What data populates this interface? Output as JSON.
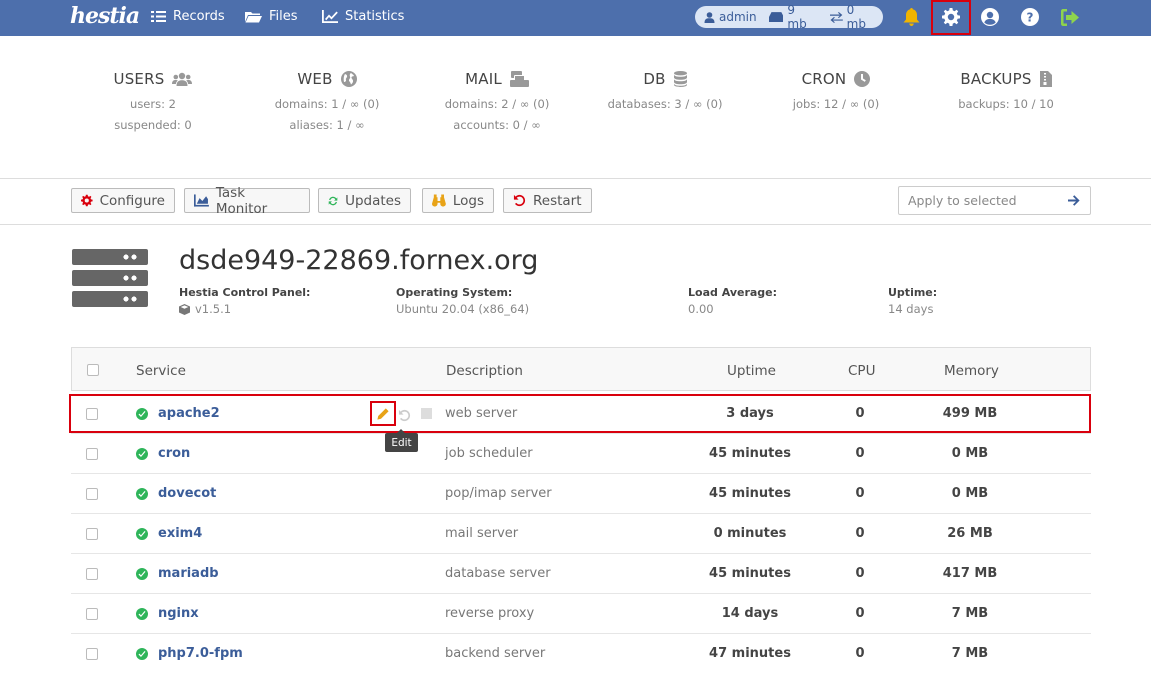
{
  "nav": {
    "logo": "hestia",
    "records": "Records",
    "files": "Files",
    "statistics": "Statistics",
    "user": "admin",
    "disk": "9 mb",
    "bandwidth": "0 mb"
  },
  "stats": [
    {
      "title": "USERS",
      "line1": "users: 2",
      "line2": "suspended: 0",
      "icon": "users-icon"
    },
    {
      "title": "WEB",
      "line1": "domains: 1 / ∞ (0)",
      "line2": "aliases: 1 / ∞",
      "icon": "globe-icon"
    },
    {
      "title": "MAIL",
      "line1": "domains: 2 / ∞ (0)",
      "line2": "accounts: 0 / ∞",
      "icon": "mail-icon"
    },
    {
      "title": "DB",
      "line1": "databases: 3 / ∞ (0)",
      "line2": "",
      "icon": "database-icon"
    },
    {
      "title": "CRON",
      "line1": "jobs: 12 / ∞ (0)",
      "line2": "",
      "icon": "clock-icon"
    },
    {
      "title": "BACKUPS",
      "line1": "backups: 10 / 10",
      "line2": "",
      "icon": "file-icon"
    }
  ],
  "toolbar": {
    "configure": "Configure",
    "task_monitor": "Task Monitor",
    "updates": "Updates",
    "logs": "Logs",
    "restart": "Restart",
    "apply_placeholder": "Apply to selected"
  },
  "server": {
    "hostname": "dsde949-22869.fornex.org",
    "panel_label": "Hestia Control Panel:",
    "panel_value": "v1.5.1",
    "os_label": "Operating System:",
    "os_value": "Ubuntu 20.04 (x86_64)",
    "load_label": "Load Average:",
    "load_value": "0.00",
    "uptime_label": "Uptime:",
    "uptime_value": "14 days"
  },
  "table": {
    "headers": {
      "service": "Service",
      "description": "Description",
      "uptime": "Uptime",
      "cpu": "CPU",
      "memory": "Memory"
    },
    "rows": [
      {
        "service": "apache2",
        "description": "web server",
        "uptime": "3 days",
        "cpu": "0",
        "memory": "499 MB"
      },
      {
        "service": "cron",
        "description": "job scheduler",
        "uptime": "45 minutes",
        "cpu": "0",
        "memory": "0 MB"
      },
      {
        "service": "dovecot",
        "description": "pop/imap server",
        "uptime": "45 minutes",
        "cpu": "0",
        "memory": "0 MB"
      },
      {
        "service": "exim4",
        "description": "mail server",
        "uptime": "0 minutes",
        "cpu": "0",
        "memory": "26 MB"
      },
      {
        "service": "mariadb",
        "description": "database server",
        "uptime": "45 minutes",
        "cpu": "0",
        "memory": "417 MB"
      },
      {
        "service": "nginx",
        "description": "reverse proxy",
        "uptime": "14 days",
        "cpu": "0",
        "memory": "7 MB"
      },
      {
        "service": "php7.0-fpm",
        "description": "backend server",
        "uptime": "47 minutes",
        "cpu": "0",
        "memory": "7 MB"
      }
    ]
  },
  "tooltip": "Edit",
  "colors": {
    "nav_bg": "#4d6fac",
    "highlight": "#d9000d",
    "ok": "#2fb55a",
    "link": "#3b5d99"
  }
}
